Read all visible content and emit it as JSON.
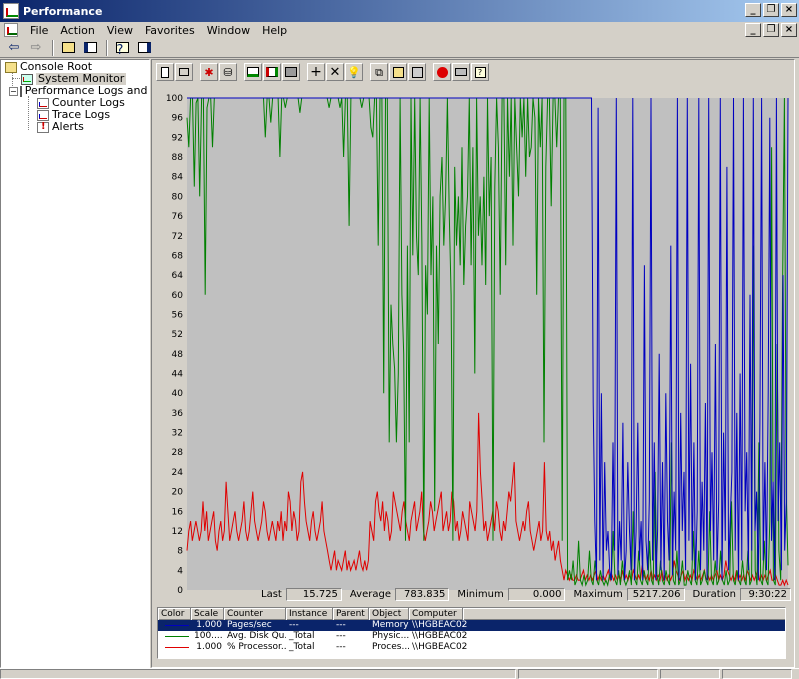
{
  "window": {
    "title": "Performance"
  },
  "menu": [
    "File",
    "Action",
    "View",
    "Favorites",
    "Window",
    "Help"
  ],
  "tree": {
    "root": "Console Root",
    "items": [
      {
        "label": "System Monitor",
        "selected": true
      },
      {
        "label": "Performance Logs and Alerts"
      },
      {
        "label": "Counter Logs"
      },
      {
        "label": "Trace Logs"
      },
      {
        "label": "Alerts"
      }
    ]
  },
  "stats": {
    "last_label": "Last",
    "last": "15.725",
    "average_label": "Average",
    "average": "783.835",
    "minimum_label": "Minimum",
    "minimum": "0.000",
    "maximum_label": "Maximum",
    "maximum": "5217.206",
    "duration_label": "Duration",
    "duration": "9:30:22"
  },
  "legend": {
    "headers": [
      "Color",
      "Scale",
      "Counter",
      "Instance",
      "Parent",
      "Object",
      "Computer"
    ],
    "rows": [
      {
        "color": "#0000c0",
        "scale": "1.000",
        "counter": "Pages/sec",
        "instance": "---",
        "parent": "---",
        "object": "Memory",
        "computer": "\\\\HGBEAC02"
      },
      {
        "color": "#008000",
        "scale": "100....",
        "counter": "Avg. Disk Qu...",
        "instance": "_Total",
        "parent": "---",
        "object": "Physic...",
        "computer": "\\\\HGBEAC02"
      },
      {
        "color": "#e00000",
        "scale": "1.000",
        "counter": "% Processor...",
        "instance": "_Total",
        "parent": "---",
        "object": "Proces...",
        "computer": "\\\\HGBEAC02"
      }
    ]
  },
  "chart_data": {
    "type": "line",
    "ylim": [
      0,
      100
    ],
    "yticks": [
      0,
      4,
      8,
      12,
      16,
      20,
      24,
      28,
      32,
      36,
      40,
      44,
      48,
      52,
      56,
      60,
      64,
      68,
      72,
      76,
      80,
      84,
      88,
      92,
      96,
      100
    ],
    "grid": false,
    "series": [
      {
        "name": "Pages/sec",
        "color": "#0000c0",
        "values": [
          100,
          100,
          100,
          100,
          100,
          100,
          100,
          100,
          100,
          100,
          100,
          100,
          100,
          100,
          100,
          100,
          100,
          100,
          100,
          100,
          100,
          100,
          100,
          100,
          100,
          100,
          100,
          100,
          100,
          100,
          100,
          100,
          100,
          100,
          100,
          100,
          100,
          100,
          100,
          100,
          100,
          100,
          100,
          100,
          100,
          100,
          100,
          100,
          100,
          100,
          100,
          100,
          100,
          100,
          100,
          100,
          100,
          100,
          100,
          100,
          100,
          100,
          100,
          100,
          100,
          100,
          100,
          100,
          100,
          100,
          100,
          100,
          100,
          100,
          100,
          100,
          100,
          100,
          100,
          100,
          100,
          100,
          100,
          100,
          100,
          100,
          100,
          100,
          100,
          100,
          100,
          100,
          100,
          100,
          100,
          100,
          100,
          100,
          100,
          100,
          100,
          100,
          100,
          100,
          100,
          100,
          100,
          100,
          100,
          100,
          100,
          100,
          100,
          100,
          100,
          100,
          100,
          100,
          100,
          100,
          100,
          100,
          100,
          100,
          100,
          100,
          100,
          100,
          100,
          100,
          100,
          100,
          100,
          100,
          100,
          100,
          100,
          100,
          100,
          100,
          100,
          100,
          100,
          100,
          100,
          100,
          100,
          100,
          100,
          100,
          100,
          100,
          100,
          100,
          100,
          100,
          100,
          100,
          100,
          100,
          100,
          100,
          100,
          100,
          100,
          100,
          100,
          100,
          100,
          100,
          100,
          100,
          100,
          100,
          100,
          100,
          100,
          100,
          100,
          100,
          100,
          100,
          100,
          100,
          100,
          100,
          100,
          100,
          100,
          100,
          100,
          100,
          100,
          100,
          100,
          100,
          100,
          100,
          100,
          100,
          100,
          100,
          100,
          100,
          100,
          100,
          100,
          100,
          100,
          100,
          100,
          100,
          100,
          100,
          100,
          100,
          100,
          100,
          100,
          100,
          100,
          100,
          100,
          100,
          100,
          100,
          100,
          100,
          100,
          100,
          100,
          100,
          100,
          100,
          100,
          100,
          100,
          100,
          100,
          100,
          100,
          100,
          100,
          100,
          100,
          100,
          38,
          14,
          2,
          98,
          6,
          40,
          2,
          26,
          8,
          12,
          4,
          2,
          30,
          8,
          100,
          3,
          14,
          6,
          34,
          2,
          8,
          26,
          12,
          4,
          100,
          2,
          12,
          34,
          6,
          14,
          2,
          66,
          10,
          4,
          18,
          100,
          6,
          30,
          2,
          12,
          48,
          4,
          26,
          2,
          40,
          14,
          6,
          70,
          3,
          20,
          8,
          100,
          2,
          36,
          12,
          24,
          4,
          100,
          10,
          46,
          6,
          30,
          2,
          16,
          100,
          4,
          22,
          8,
          38,
          2,
          100,
          12,
          28,
          6,
          50,
          4,
          18,
          100,
          2,
          32,
          10,
          86,
          4,
          14,
          24,
          100,
          8,
          36,
          2,
          44,
          6,
          100,
          16,
          28,
          4,
          60,
          8,
          100,
          12,
          20,
          2,
          34,
          100,
          6,
          26,
          4,
          40,
          96,
          10,
          22,
          2,
          100,
          14,
          30,
          4,
          64,
          8,
          18,
          100
        ]
      },
      {
        "name": "Avg. Disk Queue Length",
        "color": "#008000",
        "values": [
          96,
          90,
          100,
          100,
          82,
          99,
          100,
          80,
          100,
          100,
          60,
          98,
          100,
          100,
          90,
          100,
          100,
          100,
          100,
          100,
          100,
          100,
          100,
          100,
          100,
          100,
          100,
          100,
          100,
          100,
          100,
          100,
          100,
          100,
          100,
          100,
          100,
          100,
          100,
          100,
          100,
          100,
          100,
          92,
          100,
          100,
          95,
          100,
          100,
          100,
          100,
          88,
          100,
          100,
          98,
          100,
          100,
          100,
          100,
          100,
          100,
          100,
          97,
          100,
          100,
          100,
          100,
          100,
          100,
          100,
          100,
          100,
          100,
          100,
          100,
          100,
          100,
          100,
          98,
          100,
          100,
          100,
          100,
          100,
          98,
          100,
          88,
          100,
          100,
          74,
          100,
          100,
          100,
          100,
          100,
          100,
          98,
          100,
          100,
          100,
          100,
          94,
          92,
          100,
          100,
          70,
          100,
          100,
          40,
          100,
          100,
          30,
          58,
          50,
          45,
          30,
          44,
          100,
          60,
          48,
          10,
          70,
          30,
          100,
          68,
          100,
          72,
          64,
          100,
          70,
          10,
          66,
          56,
          100,
          64,
          80,
          16,
          70,
          50,
          80,
          88,
          70,
          80,
          100,
          76,
          60,
          10,
          86,
          70,
          80,
          66,
          90,
          62,
          74,
          80,
          100,
          66,
          90,
          44,
          100,
          72,
          80,
          66,
          84,
          62,
          100,
          76,
          88,
          10,
          82,
          100,
          90,
          60,
          100,
          100,
          66,
          100,
          84,
          100,
          70,
          100,
          90,
          80,
          100,
          92,
          100,
          84,
          100,
          88,
          90,
          100,
          96,
          60,
          100,
          90,
          100,
          30,
          86,
          100,
          100,
          78,
          100,
          100,
          90,
          100,
          100,
          10,
          100,
          100,
          2,
          4,
          2,
          6,
          1,
          2,
          10,
          2,
          1,
          3,
          1,
          2,
          8,
          2,
          1,
          6,
          2,
          1,
          4,
          2,
          1,
          2,
          1,
          3,
          2,
          12,
          2,
          1,
          4,
          1,
          6,
          2,
          1,
          2,
          4,
          1,
          16,
          2,
          1,
          8,
          2,
          1,
          4,
          2,
          1,
          10,
          2,
          1,
          24,
          3,
          1,
          6,
          2,
          1,
          4,
          2,
          1,
          30,
          2,
          1,
          8,
          1,
          2,
          6,
          1,
          1,
          4,
          2,
          1,
          12,
          2,
          1,
          8,
          1,
          2,
          4,
          2,
          1,
          16,
          2,
          1,
          6,
          1,
          2,
          8,
          2,
          1,
          4,
          1,
          2,
          18,
          2,
          1,
          4,
          2,
          1,
          6,
          2,
          1,
          8,
          1,
          2,
          70,
          4,
          1,
          30,
          2,
          1,
          10,
          2,
          1,
          14,
          90,
          2,
          1,
          50,
          8,
          2,
          60,
          100,
          20,
          5
        ]
      },
      {
        "name": "% Processor Time",
        "color": "#e00000",
        "values": [
          8,
          12,
          14,
          10,
          12,
          14,
          12,
          10,
          12,
          18,
          12,
          16,
          10,
          12,
          14,
          16,
          10,
          8,
          12,
          14,
          10,
          12,
          22,
          16,
          10,
          12,
          14,
          16,
          12,
          10,
          12,
          14,
          18,
          12,
          10,
          12,
          16,
          20,
          14,
          12,
          10,
          12,
          14,
          18,
          16,
          12,
          10,
          12,
          14,
          12,
          10,
          14,
          12,
          16,
          10,
          14,
          12,
          20,
          18,
          12,
          16,
          14,
          10,
          12,
          22,
          24,
          18,
          14,
          12,
          10,
          14,
          16,
          12,
          10,
          12,
          14,
          18,
          12,
          10,
          8,
          6,
          4,
          6,
          8,
          4,
          6,
          5,
          4,
          6,
          8,
          4,
          6,
          4,
          5,
          6,
          4,
          6,
          8,
          5,
          4,
          6,
          4,
          6,
          14,
          12,
          10,
          18,
          20,
          16,
          14,
          18,
          12,
          16,
          14,
          10,
          12,
          20,
          18,
          16,
          14,
          12,
          16,
          18,
          14,
          12,
          10,
          14,
          16,
          18,
          12,
          14,
          16,
          20,
          12,
          10,
          12,
          14,
          18,
          16,
          12,
          14,
          16,
          18,
          20,
          12,
          14,
          16,
          12,
          14,
          20,
          18,
          12,
          14,
          10,
          12,
          16,
          14,
          12,
          10,
          18,
          16,
          14,
          12,
          16,
          36,
          24,
          18,
          12,
          14,
          10,
          12,
          14,
          16,
          12,
          18,
          16,
          12,
          10,
          14,
          12,
          16,
          20,
          18,
          22,
          26,
          14,
          12,
          10,
          12,
          14,
          12,
          16,
          18,
          12,
          10,
          8,
          10,
          12,
          14,
          10,
          12,
          26,
          12,
          10,
          12,
          8,
          10,
          6,
          8,
          10,
          6,
          4,
          2,
          4,
          3,
          2,
          3,
          2,
          2,
          3,
          2,
          2,
          3,
          4,
          2,
          3,
          2,
          3,
          2,
          3,
          4,
          2,
          3,
          2,
          3,
          2,
          3,
          4,
          2,
          3,
          2,
          3,
          2,
          3,
          2,
          4,
          2,
          3,
          2,
          3,
          2,
          4,
          3,
          2,
          3,
          2,
          5,
          3,
          2,
          3,
          2,
          4,
          2,
          3,
          2,
          3,
          2,
          4,
          2,
          3,
          2,
          3,
          2,
          3,
          6,
          4,
          3,
          2,
          3,
          4,
          2,
          3,
          2,
          3,
          2,
          4,
          3,
          2,
          3,
          2,
          3,
          4,
          2,
          3,
          2,
          3,
          2,
          3,
          4,
          2,
          3,
          2,
          3,
          6,
          4,
          3,
          2,
          3,
          2,
          4,
          2,
          3,
          2,
          3,
          2,
          4,
          3,
          2,
          3,
          2,
          3,
          4,
          2,
          3,
          2,
          3,
          2,
          3,
          4,
          2,
          2,
          3,
          2,
          1,
          1,
          2,
          1,
          2,
          1
        ]
      }
    ]
  }
}
